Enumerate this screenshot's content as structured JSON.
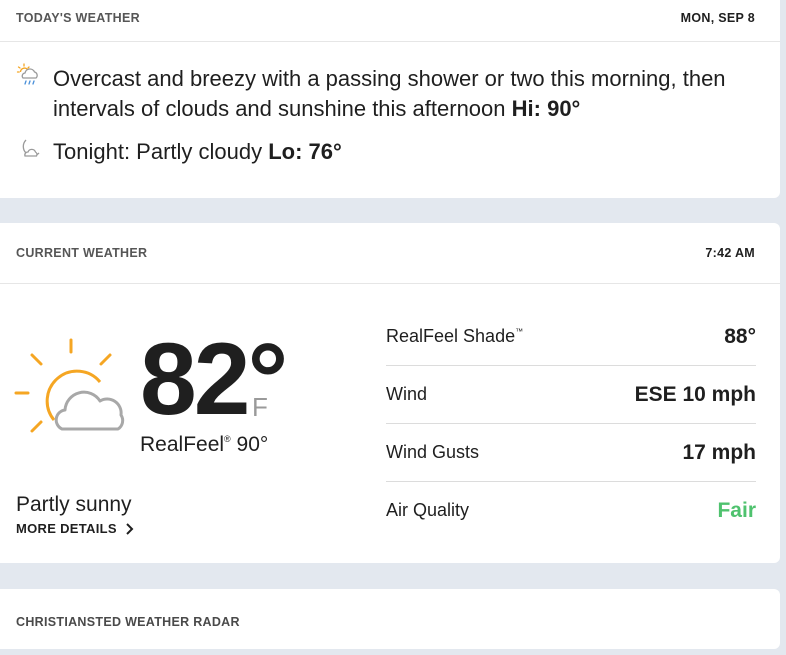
{
  "today": {
    "label": "TODAY'S WEATHER",
    "date": "MON, SEP 8",
    "day_forecast": "Overcast and breezy with a passing shower or two this morning, then intervals of clouds and sunshine this afternoon",
    "hi_label": "Hi: 90°",
    "night_forecast": "Tonight: Partly cloudy",
    "lo_label": "Lo: 76°",
    "day_icon": "cloud-rain-sun-icon",
    "night_icon": "moon-icon"
  },
  "current": {
    "label": "CURRENT WEATHER",
    "time": "7:42 AM",
    "temperature": "82°",
    "unit": "F",
    "realfeel_label": "RealFeel",
    "realfeel_mark": "®",
    "realfeel_value": "90°",
    "phrase": "Partly sunny",
    "more_details": "MORE DETAILS",
    "icon": "partly-sunny-icon",
    "details": [
      {
        "label": "RealFeel Shade",
        "mark": "™",
        "value": "88°"
      },
      {
        "label": "Wind",
        "mark": "",
        "value": "ESE 10 mph"
      },
      {
        "label": "Wind Gusts",
        "mark": "",
        "value": "17 mph"
      },
      {
        "label": "Air Quality",
        "mark": "",
        "value": "Fair"
      }
    ],
    "air_quality_color": "#4fc26e",
    "sun_color": "#f5a623"
  },
  "radar": {
    "label": "CHRISTIANSTED WEATHER RADAR"
  }
}
